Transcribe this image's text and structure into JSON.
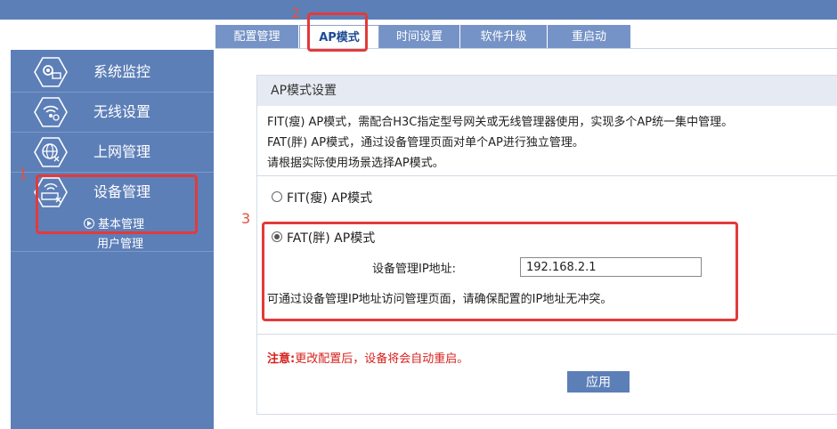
{
  "tabs": [
    {
      "label": "配置管理",
      "active": false
    },
    {
      "label": "AP模式",
      "active": true
    },
    {
      "label": "时间设置",
      "active": false
    },
    {
      "label": "软件升级",
      "active": false
    },
    {
      "label": "重启动",
      "active": false
    }
  ],
  "sidebar": {
    "items": [
      {
        "label": "系统监控",
        "icon": "monitor-gear-icon"
      },
      {
        "label": "无线设置",
        "icon": "wireless-icon"
      },
      {
        "label": "上网管理",
        "icon": "globe-icon"
      },
      {
        "label": "设备管理",
        "icon": "router-icon"
      }
    ],
    "subitems": [
      {
        "label": "基本管理",
        "icon": "arrow-circle-icon"
      },
      {
        "label": "用户管理"
      }
    ]
  },
  "panel": {
    "title": "AP模式设置",
    "desc": [
      "FIT(瘦) AP模式，需配合H3C指定型号网关或无线管理器使用，实现多个AP统一集中管理。",
      "FAT(胖) AP模式，通过设备管理页面对单个AP进行独立管理。",
      "请根据实际使用场景选择AP模式。"
    ],
    "fit_label": "FIT(瘦) AP模式",
    "fat_label": "FAT(胖) AP模式",
    "selected_mode": "FAT",
    "ip_label": "设备管理IP地址:",
    "ip_value": "192.168.2.1",
    "ip_hint": "可通过设备管理IP地址访问管理页面，请确保配置的IP地址无冲突。",
    "note_label": "注意:",
    "note_text": "更改配置后，设备将会自动重启。",
    "apply_label": "应用"
  },
  "annotations": [
    {
      "number": "1"
    },
    {
      "number": "2"
    },
    {
      "number": "3"
    }
  ],
  "colors": {
    "sidebar": "#5d7fb8",
    "tab": "#7593c6",
    "annotation": "#e33a3a",
    "warning": "#d6201c"
  }
}
